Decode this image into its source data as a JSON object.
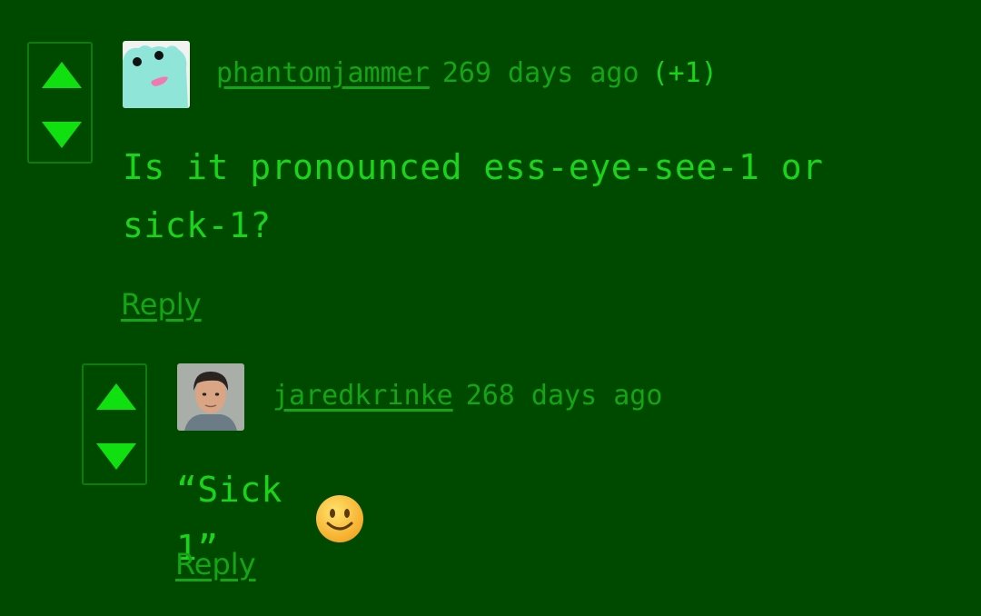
{
  "colors": {
    "background": "#004a00",
    "text": "#19d419",
    "muted": "#14a414",
    "arrow": "#10e010",
    "border": "#0f7a0f"
  },
  "comments": [
    {
      "username": "phantomjammer",
      "age": "269 days ago",
      "score": "(+1)",
      "body_lines": [
        "Is it pronounced ess-eye-see-1 or",
        "sick-1?"
      ],
      "reply_label": "Reply",
      "avatar_icon": "frog-avatar-icon"
    },
    {
      "username": "jaredkrinke",
      "age": "268 days ago",
      "body": "“Sick 1”",
      "emoji_icon": "smiling-face-icon",
      "reply_label": "Reply",
      "avatar_icon": "person-photo-avatar-icon"
    }
  ]
}
